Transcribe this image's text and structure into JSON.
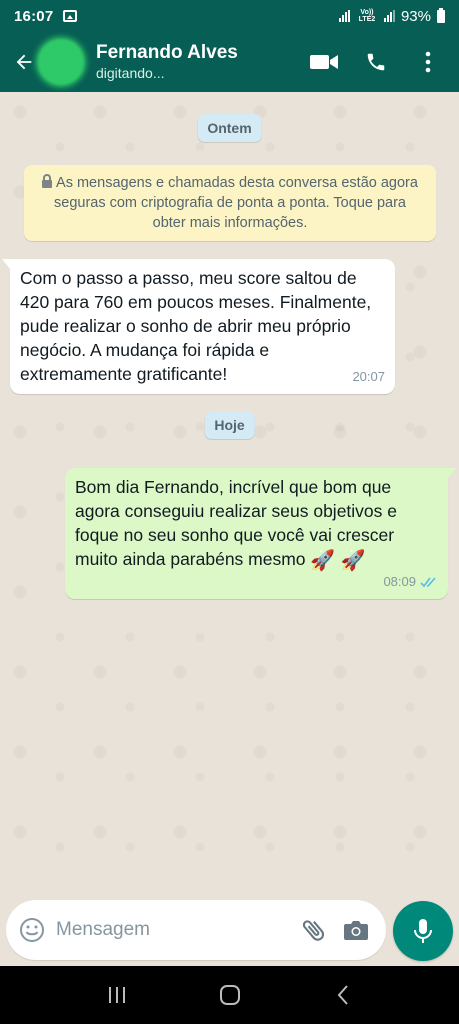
{
  "status_bar": {
    "time": "16:07",
    "network_label": "Vo)) LTE2",
    "battery": "93%"
  },
  "header": {
    "contact_name": "Fernando Alves",
    "contact_status": "digitando..."
  },
  "chat": {
    "date_yesterday": "Ontem",
    "encryption_notice": "As mensagens e chamadas desta conversa estão agora seguras com criptografia de ponta a ponta. Toque para obter mais informações.",
    "incoming": {
      "text": "Com o passo a passo, meu score saltou de 420 para 760 em poucos meses. Finalmente, pude realizar o sonho de abrir meu próprio negócio. A mudança foi rápida e extremamente gratificante!",
      "time": "20:07"
    },
    "date_today": "Hoje",
    "outgoing": {
      "text": "Bom dia Fernando, incrível que bom que agora conseguiu realizar seus objetivos e foque no seu sonho que você vai crescer muito ainda parabéns mesmo",
      "emoji": "🚀 🚀",
      "time": "08:09"
    }
  },
  "composer": {
    "placeholder": "Mensagem"
  },
  "colors": {
    "header": "#075e54",
    "outgoing_bubble": "#dcf8c6",
    "mic_button": "#00897b",
    "read_ticks": "#53bdeb"
  }
}
